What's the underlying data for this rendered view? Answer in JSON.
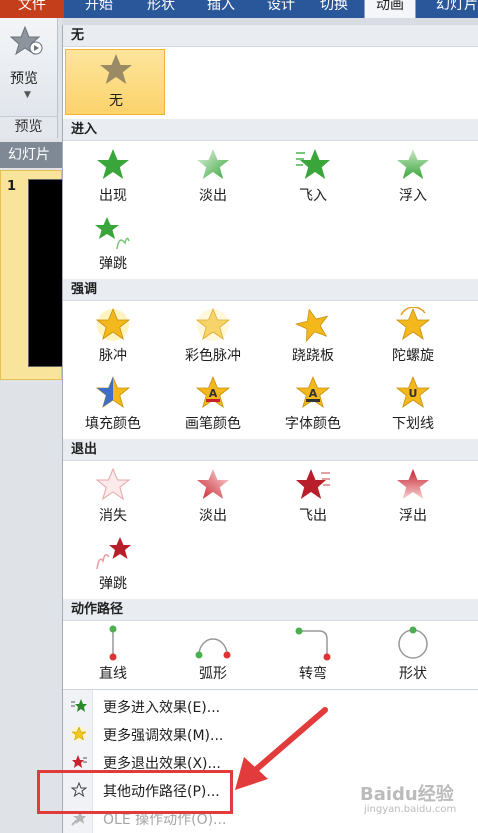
{
  "ribbon": {
    "tabs": [
      {
        "label": "文件"
      },
      {
        "label": "开始"
      },
      {
        "label": "形状"
      },
      {
        "label": "插入"
      },
      {
        "label": "设计"
      },
      {
        "label": "切换"
      },
      {
        "label": "动画"
      },
      {
        "label": "幻灯片"
      }
    ],
    "active_tab": "动画",
    "preview": {
      "label": "预览",
      "group_label": "预览"
    }
  },
  "slides_panel": {
    "tab_label": "幻灯片",
    "slide_number": "1"
  },
  "gallery": {
    "sections": [
      {
        "header": "无",
        "items": [
          {
            "label": "无",
            "icon": "star-none-icon"
          }
        ]
      },
      {
        "header": "进入",
        "items": [
          {
            "label": "出现",
            "icon": "entrance-appear-icon"
          },
          {
            "label": "淡出",
            "icon": "entrance-fade-icon"
          },
          {
            "label": "飞入",
            "icon": "entrance-fly-in-icon"
          },
          {
            "label": "浮入",
            "icon": "entrance-float-in-icon"
          },
          {
            "label": "弹跳",
            "icon": "entrance-bounce-icon"
          }
        ]
      },
      {
        "header": "强调",
        "items": [
          {
            "label": "脉冲",
            "icon": "emphasis-pulse-icon"
          },
          {
            "label": "彩色脉冲",
            "icon": "emphasis-color-pulse-icon"
          },
          {
            "label": "跷跷板",
            "icon": "emphasis-teeter-icon"
          },
          {
            "label": "陀螺旋",
            "icon": "emphasis-spin-icon"
          },
          {
            "label": "填充颜色",
            "icon": "emphasis-fill-color-icon"
          },
          {
            "label": "画笔颜色",
            "icon": "emphasis-line-color-icon"
          },
          {
            "label": "字体颜色",
            "icon": "emphasis-font-color-icon"
          },
          {
            "label": "下划线",
            "icon": "emphasis-underline-icon"
          }
        ]
      },
      {
        "header": "退出",
        "items": [
          {
            "label": "消失",
            "icon": "exit-disappear-icon"
          },
          {
            "label": "淡出",
            "icon": "exit-fade-icon"
          },
          {
            "label": "飞出",
            "icon": "exit-fly-out-icon"
          },
          {
            "label": "浮出",
            "icon": "exit-float-out-icon"
          },
          {
            "label": "弹跳",
            "icon": "exit-bounce-icon"
          }
        ]
      },
      {
        "header": "动作路径",
        "items": [
          {
            "label": "直线",
            "icon": "path-line-icon"
          },
          {
            "label": "弧形",
            "icon": "path-arc-icon"
          },
          {
            "label": "转弯",
            "icon": "path-turn-icon"
          },
          {
            "label": "形状",
            "icon": "path-shape-icon"
          }
        ]
      }
    ]
  },
  "menu": [
    {
      "label": "更多进入效果(E)...",
      "icon": "green-star-icon"
    },
    {
      "label": "更多强调效果(M)...",
      "icon": "yellow-star-icon"
    },
    {
      "label": "更多退出效果(X)...",
      "icon": "red-star-icon"
    },
    {
      "label": "其他动作路径(P)...",
      "icon": "outline-star-icon"
    },
    {
      "label": "OLE 操作动作(O)...",
      "icon": "gray-star-icon",
      "disabled": true
    }
  ],
  "watermark": {
    "text": "Baidu经验",
    "sub": "jingyan.baidu.com"
  },
  "colors": {
    "ribbon_blue": "#2a579a",
    "file_tab": "#c43e1c",
    "entrance_green": "#3aa53a",
    "emphasis_gold": "#f2b81c",
    "exit_red": "#c8202c",
    "path_green": "#4caf50",
    "path_red": "#d33",
    "annotation_red": "#e23b3b"
  }
}
